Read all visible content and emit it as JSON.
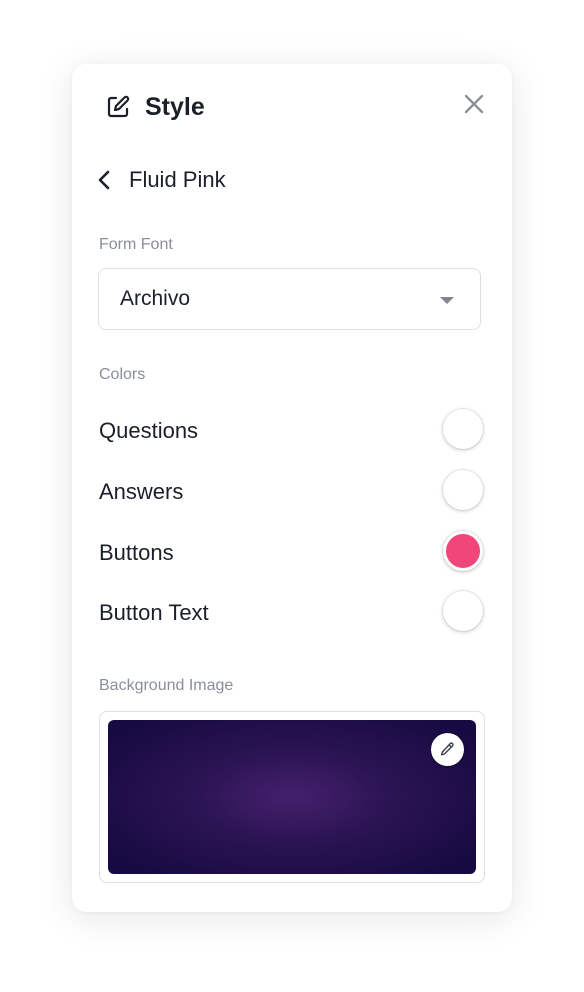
{
  "header": {
    "title": "Style",
    "icon": "edit-square-icon",
    "close_icon": "close-icon"
  },
  "theme": {
    "back_icon": "chevron-left-icon",
    "name": "Fluid Pink"
  },
  "form_font": {
    "label": "Form Font",
    "selected": "Archivo"
  },
  "colors": {
    "label": "Colors",
    "items": [
      {
        "label": "Questions",
        "color": "#ffffff"
      },
      {
        "label": "Answers",
        "color": "#ffffff"
      },
      {
        "label": "Buttons",
        "color": "#f0467a"
      },
      {
        "label": "Button Text",
        "color": "#ffffff"
      }
    ]
  },
  "background_image": {
    "label": "Background Image",
    "edit_icon": "pencil-icon"
  }
}
